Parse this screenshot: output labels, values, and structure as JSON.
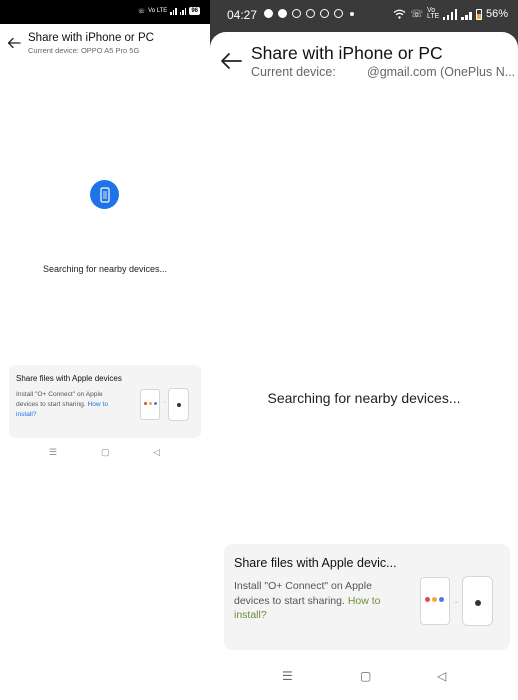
{
  "left": {
    "status": {
      "network": "Vo LTE",
      "battery": "96"
    },
    "header": {
      "title": "Share with iPhone or PC",
      "subtitle": "Current device: OPPO A5 Pro 5G"
    },
    "searching_text": "Searching for nearby devices...",
    "card": {
      "title": "Share files with Apple devices",
      "text": "Install \"O+ Connect\" on Apple devices to start sharing.",
      "link": "How to install?"
    },
    "nav": {
      "menu": "☰",
      "home": "▢",
      "back": "◁"
    },
    "colors": {
      "accent": "#1e73e8"
    }
  },
  "right": {
    "status": {
      "time": "04:27",
      "network": "Vo LTE",
      "battery": "56%"
    },
    "header": {
      "title": "Share with iPhone or PC",
      "subtitle_prefix": "Current device:",
      "subtitle_suffix": "@gmail.com (OnePlus N..."
    },
    "searching_text": "Searching for nearby devices...",
    "card": {
      "title": "Share files with Apple devic...",
      "text": "Install \"O+ Connect\" on Apple devices to start sharing.",
      "link": "How to install?"
    },
    "nav": {
      "menu": "☰",
      "home": "▢",
      "back": "◁"
    },
    "colors": {
      "link": "#6f8b3c",
      "battery": "#f2a93b"
    }
  }
}
